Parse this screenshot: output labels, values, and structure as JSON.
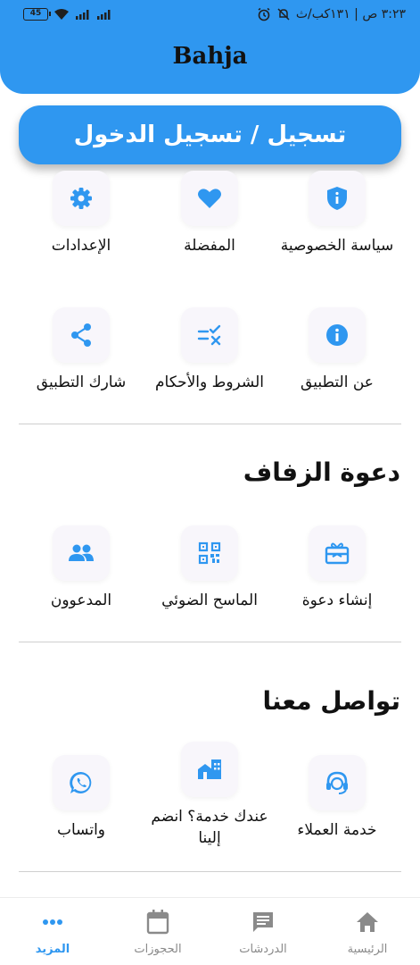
{
  "status_bar": {
    "battery": "45",
    "time": "٣:٢٣ ص | ١٣١كب/ث"
  },
  "app": {
    "title": "Bahja"
  },
  "login_button": "تسجيل / تسجيل الدخول",
  "menu": {
    "row1": [
      {
        "label": "سياسة الخصوصية",
        "icon": "shield-info-icon"
      },
      {
        "label": "المفضلة",
        "icon": "heart-icon"
      },
      {
        "label": "الإعدادات",
        "icon": "gear-icon"
      }
    ],
    "row2": [
      {
        "label": "عن التطبيق",
        "icon": "info-icon"
      },
      {
        "label": "الشروط والأحكام",
        "icon": "terms-icon"
      },
      {
        "label": "شارك التطبيق",
        "icon": "share-icon"
      }
    ]
  },
  "wedding": {
    "title": "دعوة الزفاف",
    "items": [
      {
        "label": "إنشاء دعوة",
        "icon": "gift-card-icon"
      },
      {
        "label": "الماسح الضوئي",
        "icon": "qr-code-icon"
      },
      {
        "label": "المدعوون",
        "icon": "people-icon"
      }
    ]
  },
  "contact": {
    "title": "تواصل معنا",
    "items": [
      {
        "label": "خدمة العملاء",
        "icon": "headset-icon"
      },
      {
        "label": "عندك خدمة؟ انضم إلينا",
        "icon": "store-icon"
      },
      {
        "label": "واتساب",
        "icon": "whatsapp-icon"
      }
    ]
  },
  "bottom_nav": [
    {
      "label": "الرئيسية",
      "icon": "home-icon",
      "active": false
    },
    {
      "label": "الدردشات",
      "icon": "chat-icon",
      "active": false
    },
    {
      "label": "الحجوزات",
      "icon": "calendar-icon",
      "active": false
    },
    {
      "label": "المزيد",
      "icon": "more-icon",
      "active": true
    }
  ],
  "colors": {
    "primary": "#2f97f0",
    "tile_bg": "#f8f6fb",
    "inactive_nav": "#8a8a8a"
  }
}
